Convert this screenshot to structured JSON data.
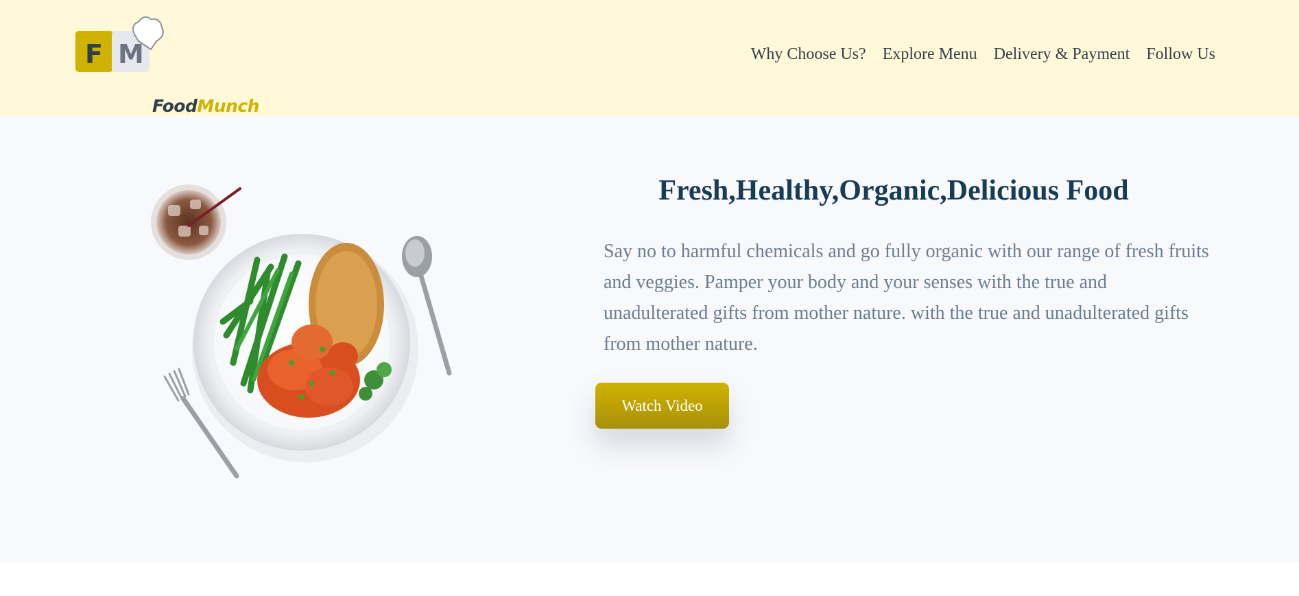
{
  "navbar": {
    "brand_part1": "Food",
    "brand_part2": "Munch",
    "logo_letter_left": "F",
    "logo_letter_right": "M",
    "links": [
      "Why Choose Us?",
      "Explore Menu",
      "Delivery & Payment",
      "Follow Us"
    ]
  },
  "banner": {
    "heading": "Fresh,Healthy,Organic,Delicious Food",
    "description": "Say no to harmful chemicals and go fully organic with our range of fresh fruits and veggies. Pamper your body and your senses with the true and unadulterated gifts from mother nature. with the true and unadulterated gifts from mother nature.",
    "button_label": "Watch Video"
  },
  "colors": {
    "navbar_bg": "#fff8d9",
    "banner_bg": "#f8f9fd",
    "heading": "#183b56",
    "text": "#6c7d8f",
    "accent": "#d0b200"
  },
  "icons": [
    "foodmunch-logo-icon",
    "chef-hat-icon",
    "food-plate-image"
  ]
}
